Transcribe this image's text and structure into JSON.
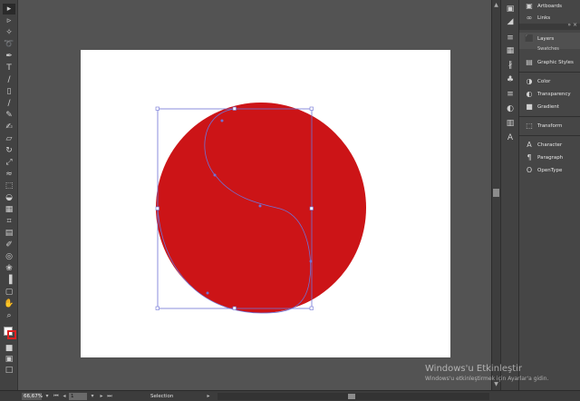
{
  "colors": {
    "shape_fill": "#cc1417",
    "selection": "#6f73d6",
    "artboard": "#ffffff",
    "workspace": "#535353"
  },
  "toolbar": {
    "icons": [
      "selection-icon",
      "direct-selection-icon",
      "magic-wand-icon",
      "lasso-icon",
      "pen-icon",
      "type-icon",
      "line-segment-icon",
      "rectangle-icon",
      "paintbrush-icon",
      "pencil-icon",
      "blob-brush-icon",
      "eraser-icon",
      "rotate-icon",
      "scale-icon",
      "warp-icon",
      "free-transform-icon",
      "shape-builder-icon",
      "perspective-grid-icon",
      "mesh-icon",
      "gradient-icon",
      "eyedropper-icon",
      "blend-icon",
      "symbol-sprayer-icon",
      "column-graph-icon",
      "artboard-icon",
      "slice-icon",
      "hand-icon",
      "zoom-icon"
    ]
  },
  "panels": {
    "artboards": "Artboards",
    "links": "Links",
    "layers": "Layers",
    "swatches": "Swatches",
    "graphic_styles": "Graphic Styles",
    "color": "Color",
    "transparency": "Transparency",
    "gradient": "Gradient",
    "transform": "Transform",
    "character": "Character",
    "paragraph": "Paragraph",
    "opentype": "OpenType"
  },
  "status": {
    "zoom": "66,67%",
    "page": "1",
    "tool": "Selection"
  },
  "watermark": {
    "title": "Windows'u Etkinleştir",
    "subtitle": "Windows'u etkinleştirmek için Ayarlar'a gidin."
  }
}
